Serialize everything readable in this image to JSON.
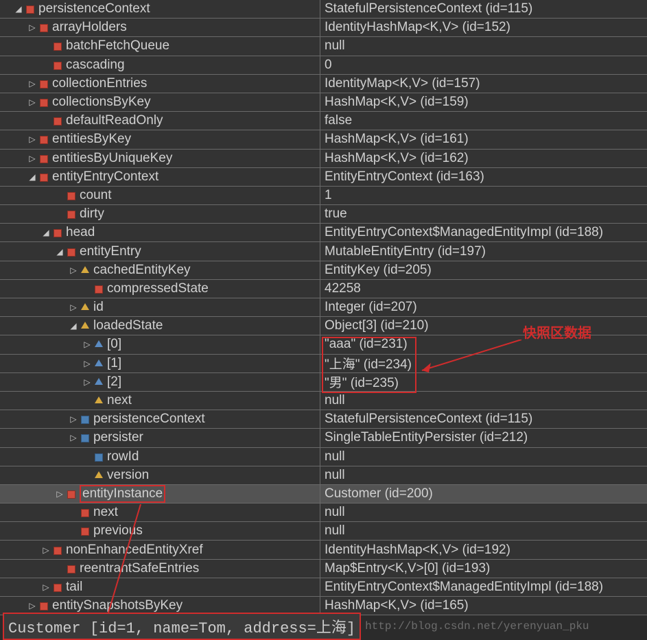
{
  "rows": [
    {
      "indent": 1,
      "exp": "down",
      "icon": "red",
      "name": "persistenceContext",
      "value": "StatefulPersistenceContext  (id=115)"
    },
    {
      "indent": 2,
      "exp": "right",
      "icon": "red",
      "name": "arrayHolders",
      "value": "IdentityHashMap<K,V>  (id=152)"
    },
    {
      "indent": 3,
      "exp": "",
      "icon": "red",
      "name": "batchFetchQueue",
      "value": "null"
    },
    {
      "indent": 3,
      "exp": "",
      "icon": "red",
      "name": "cascading",
      "value": "0"
    },
    {
      "indent": 2,
      "exp": "right",
      "icon": "red",
      "name": "collectionEntries",
      "value": "IdentityMap<K,V>  (id=157)"
    },
    {
      "indent": 2,
      "exp": "right",
      "icon": "red",
      "name": "collectionsByKey",
      "value": "HashMap<K,V>  (id=159)"
    },
    {
      "indent": 3,
      "exp": "",
      "icon": "red",
      "name": "defaultReadOnly",
      "value": "false"
    },
    {
      "indent": 2,
      "exp": "right",
      "icon": "red",
      "name": "entitiesByKey",
      "value": "HashMap<K,V>  (id=161)"
    },
    {
      "indent": 2,
      "exp": "right",
      "icon": "red",
      "name": "entitiesByUniqueKey",
      "value": "HashMap<K,V>  (id=162)"
    },
    {
      "indent": 2,
      "exp": "down",
      "icon": "red",
      "name": "entityEntryContext",
      "value": "EntityEntryContext  (id=163)"
    },
    {
      "indent": 4,
      "exp": "",
      "icon": "red",
      "name": "count",
      "value": "1"
    },
    {
      "indent": 4,
      "exp": "",
      "icon": "red",
      "name": "dirty",
      "value": "true"
    },
    {
      "indent": 3,
      "exp": "down",
      "icon": "red",
      "name": "head",
      "value": "EntityEntryContext$ManagedEntityImpl  (id=188)"
    },
    {
      "indent": 4,
      "exp": "down",
      "icon": "red",
      "name": "entityEntry",
      "value": "MutableEntityEntry  (id=197)"
    },
    {
      "indent": 5,
      "exp": "right",
      "icon": "yellow",
      "name": "cachedEntityKey",
      "value": "EntityKey  (id=205)"
    },
    {
      "indent": 6,
      "exp": "",
      "icon": "red",
      "name": "compressedState",
      "value": "42258"
    },
    {
      "indent": 5,
      "exp": "right",
      "icon": "yellow",
      "name": "id",
      "value": "Integer  (id=207)"
    },
    {
      "indent": 5,
      "exp": "down",
      "icon": "yellow",
      "name": "loadedState",
      "value": "Object[3]  (id=210)"
    },
    {
      "indent": 6,
      "exp": "right",
      "icon": "blue",
      "name": "[0]",
      "value": "\"aaa\" (id=231)"
    },
    {
      "indent": 6,
      "exp": "right",
      "icon": "blue",
      "name": "[1]",
      "value": "\"上海\" (id=234)"
    },
    {
      "indent": 6,
      "exp": "right",
      "icon": "blue",
      "name": "[2]",
      "value": "\"男\" (id=235)"
    },
    {
      "indent": 6,
      "exp": "",
      "icon": "yellow",
      "name": "next",
      "value": "null"
    },
    {
      "indent": 5,
      "exp": "right",
      "icon": "bluebox",
      "name": "persistenceContext",
      "value": "StatefulPersistenceContext  (id=115)"
    },
    {
      "indent": 5,
      "exp": "right",
      "icon": "bluebox",
      "name": "persister",
      "value": "SingleTableEntityPersister  (id=212)"
    },
    {
      "indent": 6,
      "exp": "",
      "icon": "bluebox",
      "name": "rowId",
      "value": "null"
    },
    {
      "indent": 6,
      "exp": "",
      "icon": "yellow",
      "name": "version",
      "value": "null"
    },
    {
      "indent": 4,
      "exp": "right",
      "icon": "red",
      "name": "entityInstance",
      "value": "Customer  (id=200)",
      "selected": true,
      "boxName": true
    },
    {
      "indent": 5,
      "exp": "",
      "icon": "red",
      "name": "next",
      "value": "null"
    },
    {
      "indent": 5,
      "exp": "",
      "icon": "red",
      "name": "previous",
      "value": "null"
    },
    {
      "indent": 3,
      "exp": "right",
      "icon": "red",
      "name": "nonEnhancedEntityXref",
      "value": "IdentityHashMap<K,V>  (id=192)"
    },
    {
      "indent": 4,
      "exp": "",
      "icon": "red",
      "name": "reentrantSafeEntries",
      "value": "Map$Entry<K,V>[0]  (id=193)"
    },
    {
      "indent": 3,
      "exp": "right",
      "icon": "red",
      "name": "tail",
      "value": "EntityEntryContext$ManagedEntityImpl  (id=188)"
    },
    {
      "indent": 2,
      "exp": "right",
      "icon": "red",
      "name": "entitySnapshotsByKey",
      "value": "HashMap<K,V>  (id=165)"
    }
  ],
  "annotation": "快照区数据",
  "footer": "Customer [id=1, name=Tom, address=上海]",
  "watermark": "http://blog.csdn.net/yerenyuan_pku"
}
